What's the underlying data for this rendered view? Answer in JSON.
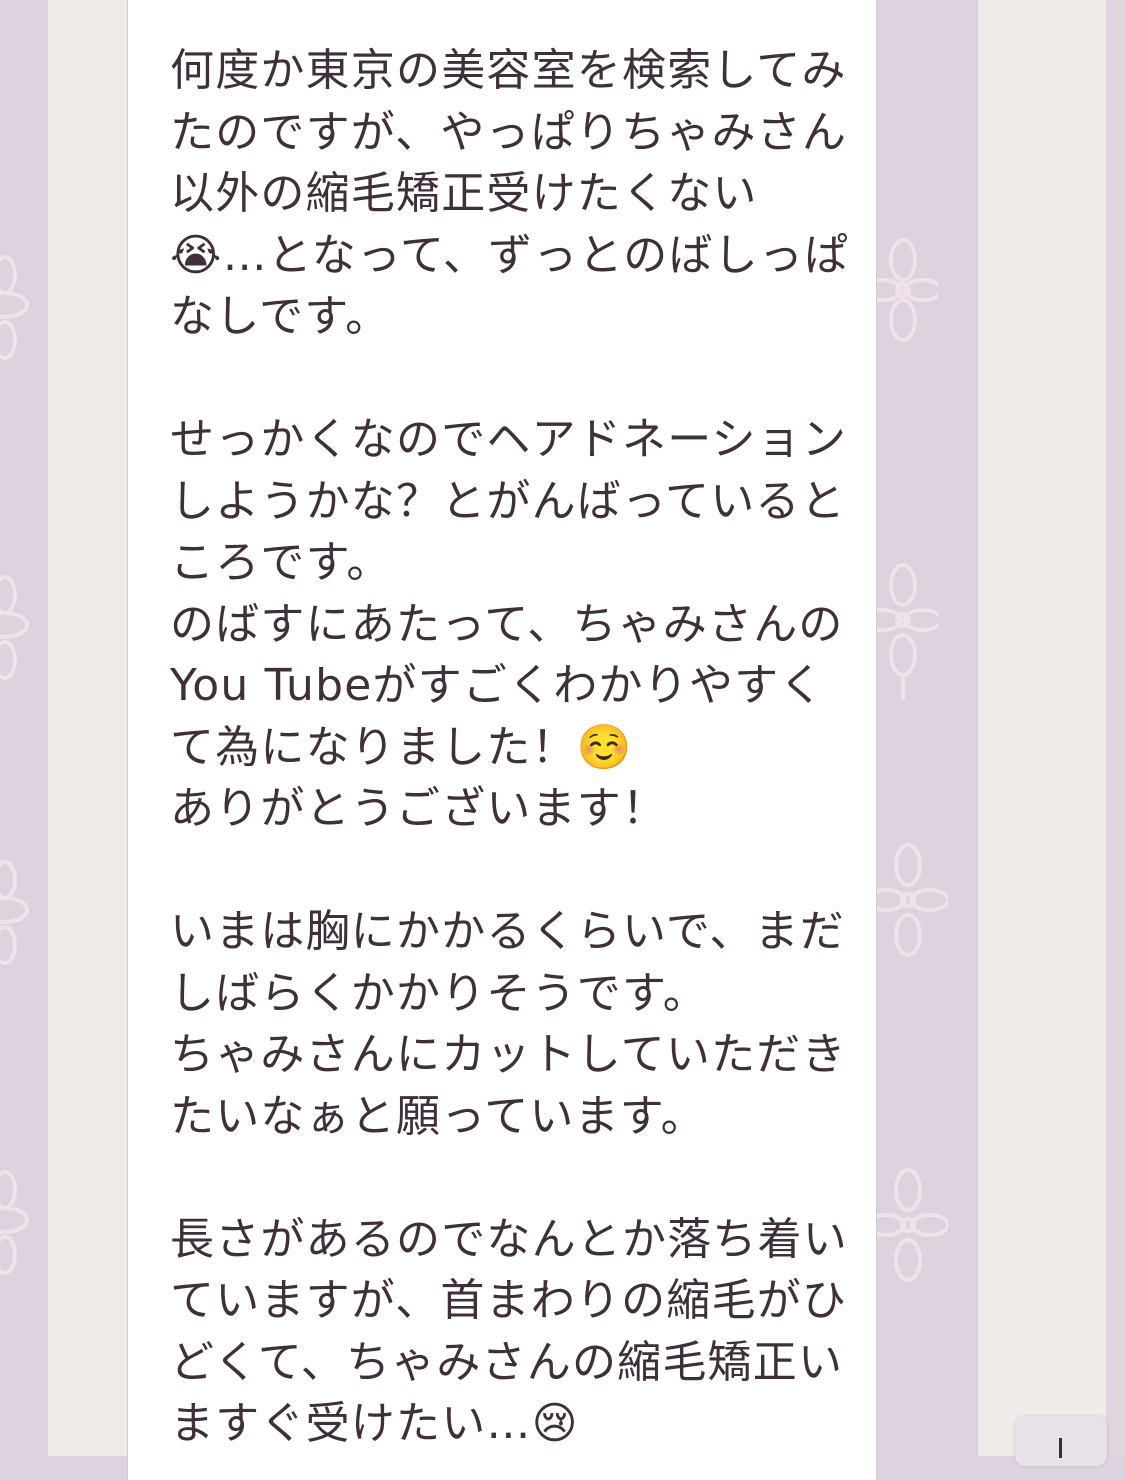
{
  "chat": {
    "message_text": "何度か東京の美容室を検索してみたのですが、やっぱりちゃみさん以外の縮毛矯正受けたくない😭…となって、ずっとのばしっぱなしです。\n\nせっかくなのでヘアドネーションしようかな？とがんばっているところです。\nのばすにあたって、ちゃみさんのYou Tubeがすごくわかりやすくて為になりました！☺️\nありがとうございます！\n\nいまは胸にかかるくらいで、まだしばらくかかりそうです。\nちゃみさんにカットしていただきたいなぁと願っています。\n\n長さがあるのでなんとか落ち着いていますが、首まわりの縮毛がひどくて、ちゃみさんの縮毛矯正いますぐ受けたい…😢"
  },
  "background": {
    "color": "#ddd3de",
    "strip_color": "#eeebe8",
    "flower_color": "#efe2ea",
    "decoration": "flower-icon"
  },
  "scroll_button": {
    "icon": "arrow-down-icon"
  }
}
